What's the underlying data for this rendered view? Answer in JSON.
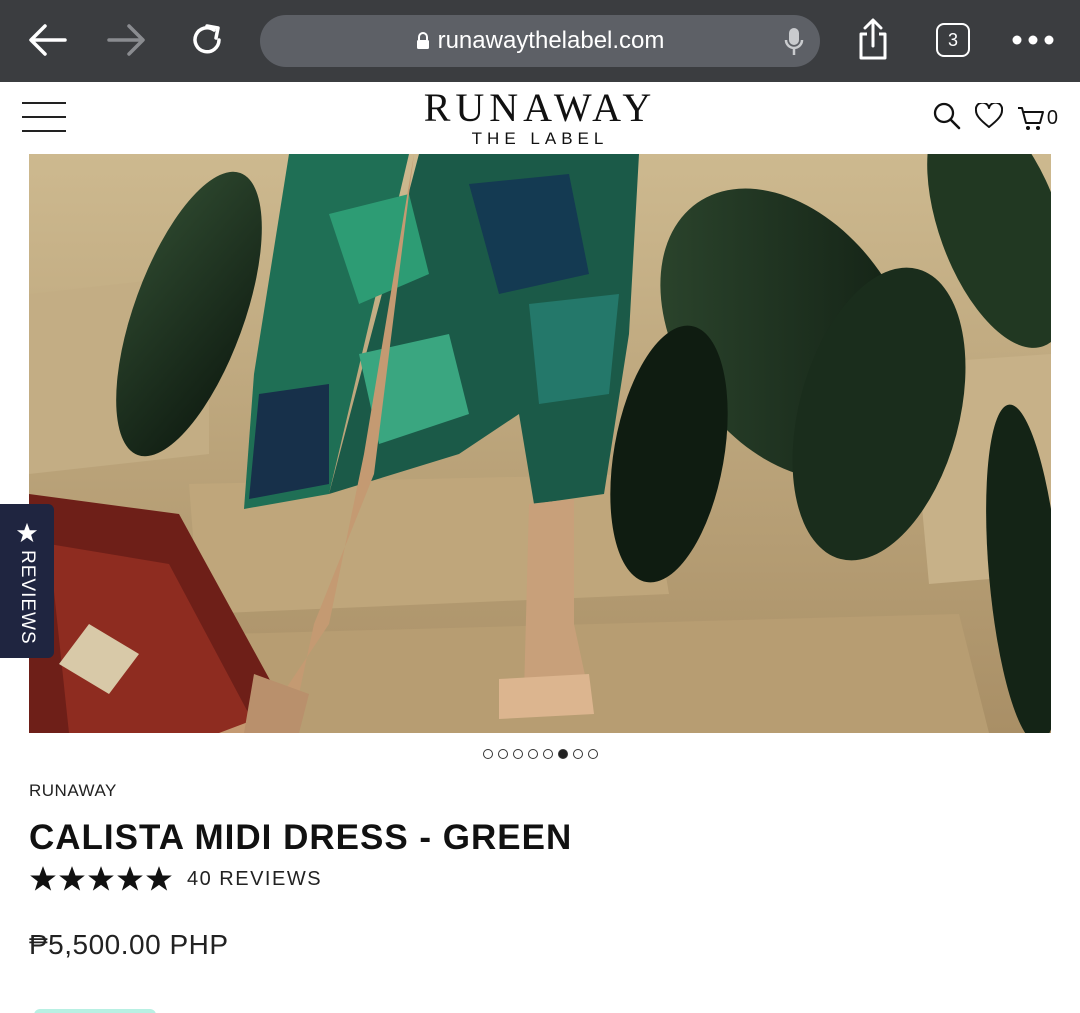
{
  "browser": {
    "url": "runawaythelabel.com",
    "tab_count": "3"
  },
  "site": {
    "logo_main": "RUNAWAY",
    "logo_sub": "THE LABEL",
    "cart_count": "0"
  },
  "gallery": {
    "total_images": 8,
    "active_index": 5
  },
  "reviews_tab": {
    "label": "REVIEWS"
  },
  "product": {
    "brand": "RUNAWAY",
    "title": "CALISTA MIDI DRESS - GREEN",
    "rating": 5,
    "review_count": "40 REVIEWS",
    "price": "₱5,500.00 PHP"
  },
  "colors": {
    "browser_bar": "#3b3d40",
    "url_pill": "#5d6066",
    "reviews_tab": "#1f2540",
    "accent_teal": "#b8f0e3"
  }
}
